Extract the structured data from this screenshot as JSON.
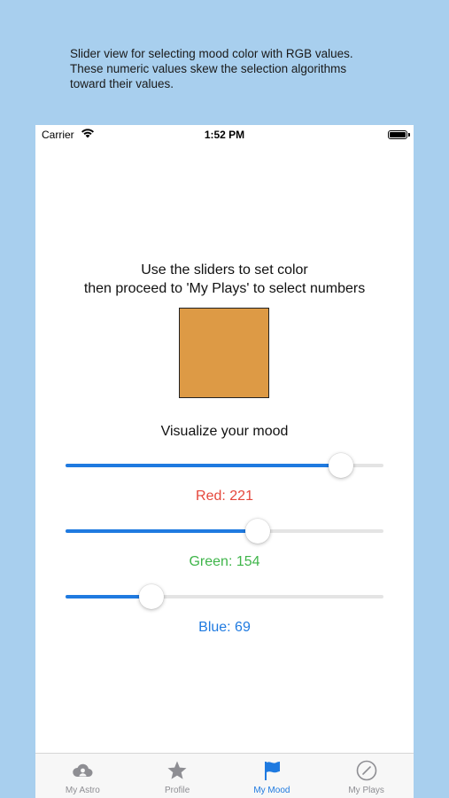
{
  "caption": {
    "line1": "Slider view for  selecting mood color with RGB values.",
    "line2": "These numeric values skew the selection algorithms",
    "line3": "toward their values."
  },
  "status_bar": {
    "carrier": "Carrier",
    "time": "1:52 PM",
    "wifi_icon": "wifi-icon",
    "battery_icon": "battery-icon"
  },
  "screen": {
    "instruction_line1": "Use the sliders to set color",
    "instruction_line2": "then proceed to 'My Plays' to select numbers",
    "visualize_label": "Visualize your mood",
    "swatch_color": "#dd9a45"
  },
  "sliders": [
    {
      "name": "red",
      "label": "Red: 221",
      "value": 221,
      "max": 255,
      "label_color": "#e5473c"
    },
    {
      "name": "green",
      "label": "Green: 154",
      "value": 154,
      "max": 255,
      "label_color": "#3fb54a"
    },
    {
      "name": "blue",
      "label": "Blue: 69",
      "value": 69,
      "max": 255,
      "label_color": "#1f7ae0"
    }
  ],
  "colors": {
    "accent": "#1f7ae0",
    "background": "#a8cfee"
  },
  "tabs": [
    {
      "label": "My Astro",
      "icon": "cloud-person-icon",
      "active": false
    },
    {
      "label": "Profile",
      "icon": "star-icon",
      "active": false
    },
    {
      "label": "My Mood",
      "icon": "flag-icon",
      "active": true
    },
    {
      "label": "My Plays",
      "icon": "compass-icon",
      "active": false
    }
  ]
}
